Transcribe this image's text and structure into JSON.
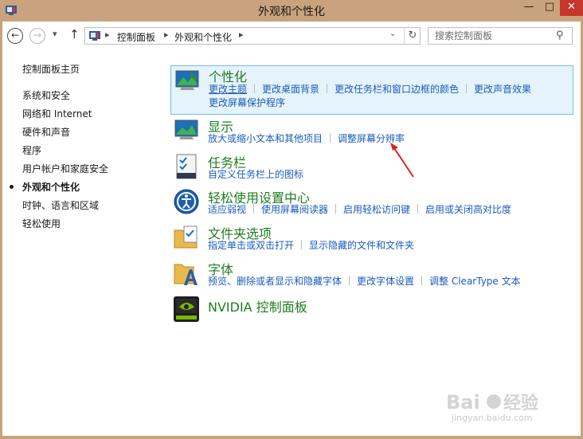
{
  "window": {
    "title": "外观和个性化",
    "minimize": "—",
    "maximize": "□",
    "close": "✕"
  },
  "nav": {
    "back": "←",
    "forward": "→",
    "recent": "▾",
    "up": "↑"
  },
  "address": {
    "crumbs": [
      "控制面板",
      "外观和个性化"
    ],
    "separator": "▸",
    "dropdown": "⌄",
    "refresh": "↻"
  },
  "search": {
    "placeholder": "搜索控制面板",
    "icon": "search-icon"
  },
  "sidebar": {
    "home": "控制面板主页",
    "items": [
      {
        "label": "系统和安全",
        "active": false
      },
      {
        "label": "网络和 Internet",
        "active": false
      },
      {
        "label": "硬件和声音",
        "active": false
      },
      {
        "label": "程序",
        "active": false
      },
      {
        "label": "用户帐户和家庭安全",
        "active": false
      },
      {
        "label": "外观和个性化",
        "active": true
      },
      {
        "label": "时钟、语言和区域",
        "active": false
      },
      {
        "label": "轻松使用",
        "active": false
      }
    ]
  },
  "categories": [
    {
      "title": "个性化",
      "icon": "personalization-icon",
      "highlighted": true,
      "links": [
        "更改主题",
        "更改桌面背景",
        "更改任务栏和窗口边框的颜色",
        "更改声音效果"
      ],
      "links_row2": [
        "更改屏幕保护程序"
      ]
    },
    {
      "title": "显示",
      "icon": "display-icon",
      "links": [
        "放大或缩小文本和其他项目",
        "调整屏幕分辨率"
      ]
    },
    {
      "title": "任务栏",
      "icon": "taskbar-icon",
      "links": [
        "自定义任务栏上的图标"
      ]
    },
    {
      "title": "轻松使用设置中心",
      "icon": "ease-of-access-icon",
      "links": [
        "适应弱视",
        "使用屏幕阅读器",
        "启用轻松访问键",
        "启用或关闭高对比度"
      ]
    },
    {
      "title": "文件夹选项",
      "icon": "folder-options-icon",
      "links": [
        "指定单击或双击打开",
        "显示隐藏的文件和文件夹"
      ]
    },
    {
      "title": "字体",
      "icon": "fonts-icon",
      "links": [
        "预览、删除或者显示和隐藏字体",
        "更改字体设置",
        "调整 ClearType 文本"
      ]
    },
    {
      "title": "NVIDIA 控制面板",
      "icon": "nvidia-icon",
      "links": []
    }
  ],
  "colors": {
    "titlebar": "#c9a37d",
    "close_button": "#c7362b",
    "category_title": "#1e7d1e",
    "link": "#1a5bbd",
    "highlight_bg": "#e5f3fb",
    "highlight_border": "#70c0e7",
    "annotation_arrow": "#e02020"
  },
  "watermark": {
    "text": "jingyan.baidu.com"
  }
}
